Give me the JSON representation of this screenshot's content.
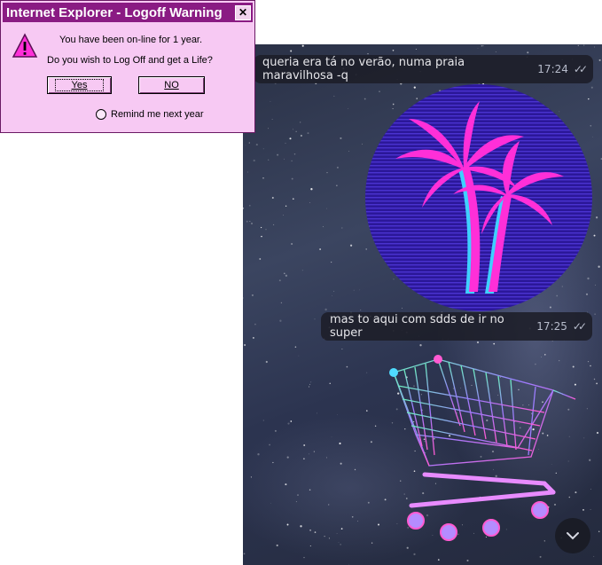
{
  "dialog": {
    "title": "Internet Explorer - Logoff Warning",
    "close_glyph": "✕",
    "message_line1": "You have been on-line for 1 year.",
    "message_line2": "Do you wish to Log Off and get a Life?",
    "yes_label": "Yes",
    "no_label": "NO",
    "radio_label": "Remind me next year",
    "radio_checked": false,
    "icon": "warning-icon"
  },
  "chat": {
    "messages": [
      {
        "text": "queria era tá no verão, numa praia maravilhosa -q",
        "time": "17:24",
        "status": "read"
      },
      {
        "text": "mas to aqui com sdds de ir no super",
        "time": "17:25",
        "status": "read"
      }
    ],
    "images": [
      "palm-tree-sticker",
      "shopping-cart-sticker"
    ],
    "scroll_down_icon": "chevron-down-icon"
  },
  "colors": {
    "dialog_bg": "#f7c9f3",
    "titlebar": "#8a1b83",
    "bubble_bg": "#1c1e28",
    "palm_circle": "#3a1fb0",
    "palm_tree": "#ff2fd8"
  }
}
